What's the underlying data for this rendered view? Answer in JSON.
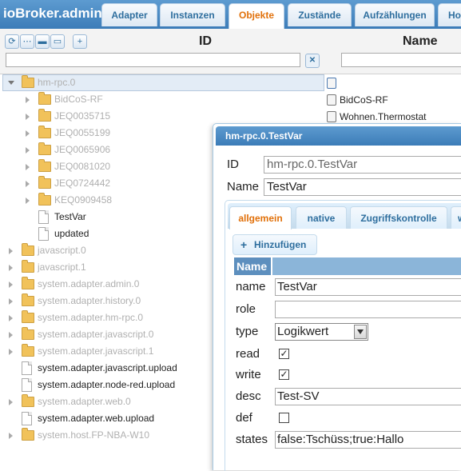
{
  "app": {
    "title": "ioBroker.admin"
  },
  "nav_tabs": [
    {
      "label": "Adapter"
    },
    {
      "label": "Instanzen"
    },
    {
      "label": "Objekte"
    },
    {
      "label": "Zustände"
    },
    {
      "label": "Aufzählungen"
    },
    {
      "label": "Ho"
    }
  ],
  "toolbar": {
    "id_header": "ID",
    "name_header": "Name"
  },
  "tree": [
    {
      "label": "hm-rpc.0",
      "style": "grey",
      "names": []
    },
    {
      "label": "BidCoS-RF",
      "style": "grey"
    },
    {
      "label": "JEQ0035715",
      "style": "grey"
    },
    {
      "label": "JEQ0055199",
      "style": "grey"
    },
    {
      "label": "JEQ0065906",
      "style": "grey"
    },
    {
      "label": "JEQ0081020",
      "style": "grey"
    },
    {
      "label": "JEQ0724442",
      "style": "grey"
    },
    {
      "label": "KEQ0909458",
      "style": "grey"
    },
    {
      "label": "TestVar",
      "style": "dark"
    },
    {
      "label": "updated",
      "style": "dark"
    },
    {
      "label": "javascript.0",
      "style": "grey"
    },
    {
      "label": "javascript.1",
      "style": "grey"
    },
    {
      "label": "system.adapter.admin.0",
      "style": "grey"
    },
    {
      "label": "system.adapter.history.0",
      "style": "grey"
    },
    {
      "label": "system.adapter.hm-rpc.0",
      "style": "grey"
    },
    {
      "label": "system.adapter.javascript.0",
      "style": "grey"
    },
    {
      "label": "system.adapter.javascript.1",
      "style": "grey"
    },
    {
      "label": "system.adapter.javascript.upload",
      "style": "dark"
    },
    {
      "label": "system.adapter.node-red.upload",
      "style": "dark"
    },
    {
      "label": "system.adapter.web.0",
      "style": "grey"
    },
    {
      "label": "system.adapter.web.upload",
      "style": "dark"
    },
    {
      "label": "system.host.FP-NBA-W10",
      "style": "grey"
    }
  ],
  "names": {
    "bidcos": "BidCoS-RF",
    "wohnen": "Wohnen.Thermostat"
  },
  "dialog": {
    "title": "hm-rpc.0.TestVar",
    "id_label": "ID",
    "id_value": "hm-rpc.0.TestVar",
    "name_label": "Name",
    "name_value": "TestVar",
    "tabs": [
      {
        "label": "allgemein"
      },
      {
        "label": "native"
      },
      {
        "label": "Zugriffskontrolle"
      },
      {
        "label": "w"
      }
    ],
    "add_button": "Hinzufügen",
    "grid_header": "Name",
    "props": {
      "name_label": "name",
      "name_value": "TestVar",
      "role_label": "role",
      "role_value": "",
      "type_label": "type",
      "type_value": "Logikwert",
      "read_label": "read",
      "read_checked": true,
      "write_label": "write",
      "write_checked": true,
      "desc_label": "desc",
      "desc_value": "Test-SV",
      "def_label": "def",
      "def_checked": false,
      "states_label": "states",
      "states_value": "false:Tschüss;true:Hallo"
    }
  }
}
